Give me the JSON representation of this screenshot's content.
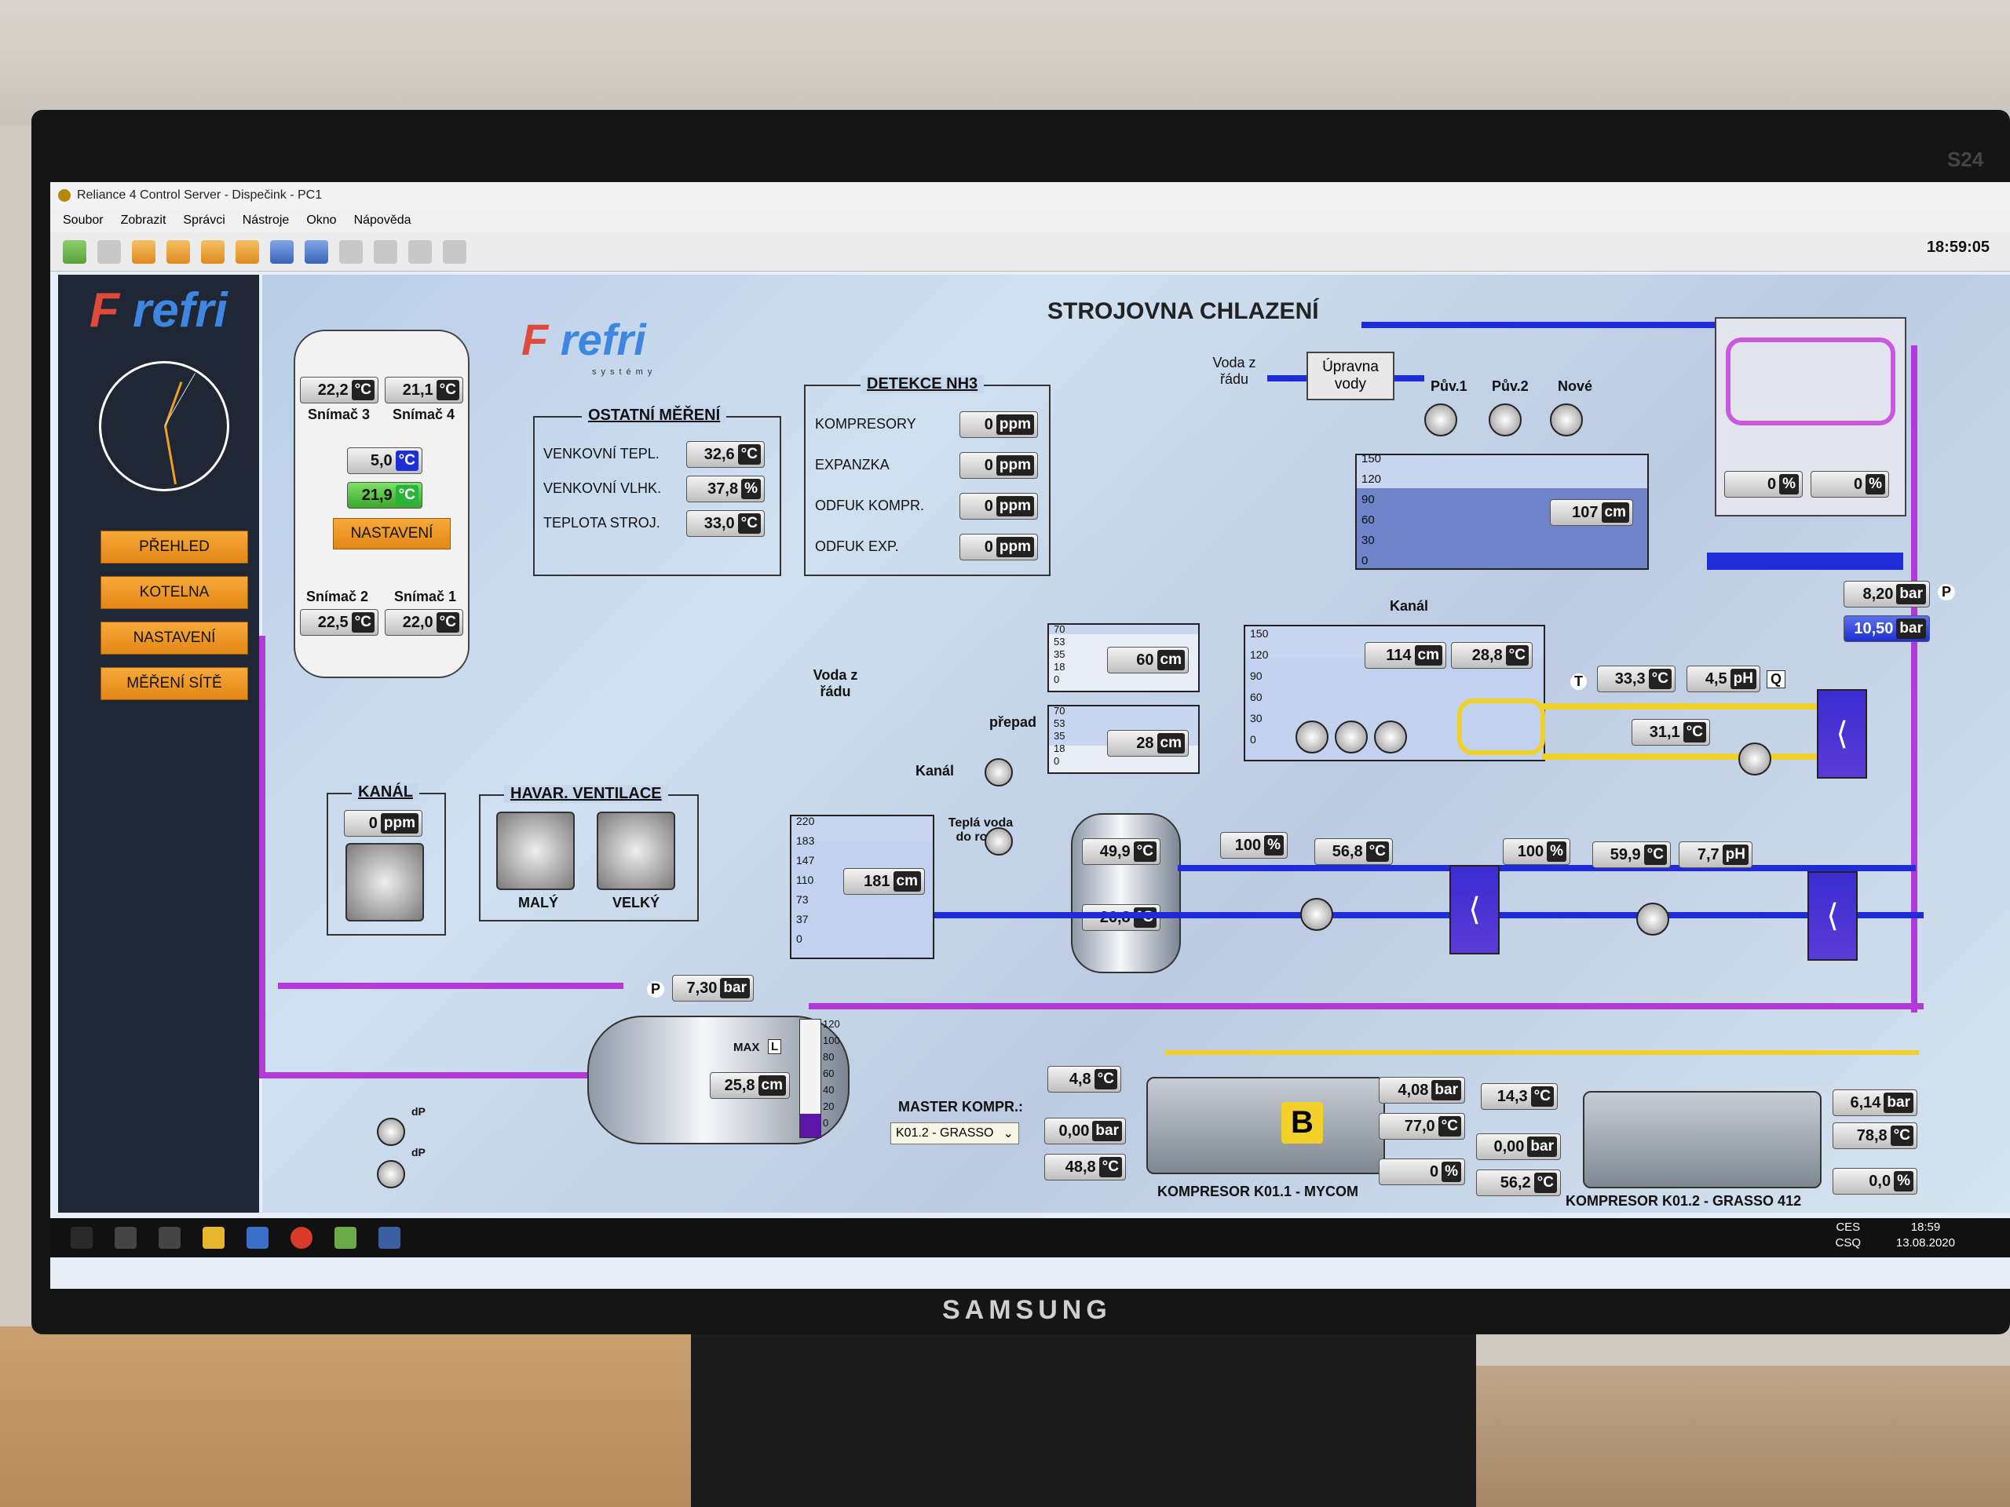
{
  "window": {
    "title": "Reliance 4 Control Server - Dispečink - PC1"
  },
  "menu": [
    "Soubor",
    "Zobrazit",
    "Správci",
    "Nástroje",
    "Okno",
    "Nápověda"
  ],
  "toolbar": {
    "time": "18:59:05"
  },
  "sidebar": {
    "logo": "refri",
    "nav": [
      "PŘEHLED",
      "KOTELNA",
      "NASTAVENÍ",
      "MĚŘENÍ SÍTĚ"
    ]
  },
  "main": {
    "title": "STROJOVNA CHLAZENÍ",
    "logo": "refri",
    "logo_sub": "systémy",
    "rink": {
      "s3": {
        "value": "22,2",
        "unit": "°C",
        "label": "Snímač 3"
      },
      "s4": {
        "value": "21,1",
        "unit": "°C",
        "label": "Snímač 4"
      },
      "blue_temp": {
        "value": "5,0",
        "unit": "°C"
      },
      "green_temp": {
        "value": "21,9",
        "unit": "°C"
      },
      "settings": "NASTAVENÍ",
      "s2": {
        "value": "22,5",
        "unit": "°C",
        "label": "Snímač 2"
      },
      "s1": {
        "value": "22,0",
        "unit": "°C",
        "label": "Snímač 1"
      }
    },
    "other_measurements": {
      "title": "OSTATNÍ MĚŘENÍ",
      "rows": [
        {
          "label": "VENKOVNÍ TEPL.",
          "value": "32,6",
          "unit": "°C"
        },
        {
          "label": "VENKOVNÍ VLHK.",
          "value": "37,8",
          "unit": "%"
        },
        {
          "label": "TEPLOTA STROJ.",
          "value": "33,0",
          "unit": "°C"
        }
      ]
    },
    "nh3": {
      "title": "DETEKCE NH3",
      "rows": [
        {
          "label": "KOMPRESORY",
          "value": "0",
          "unit": "ppm"
        },
        {
          "label": "EXPANZKA",
          "value": "0",
          "unit": "ppm"
        },
        {
          "label": "ODFUK KOMPR.",
          "value": "0",
          "unit": "ppm"
        },
        {
          "label": "ODFUK EXP.",
          "value": "0",
          "unit": "ppm"
        }
      ]
    },
    "water_treatment": {
      "source_label": "Voda z řádu",
      "box": "Úpravna vody",
      "pumps": [
        "Pův.1",
        "Pův.2",
        "Nové"
      ],
      "tank_scale": [
        "150",
        "120",
        "90",
        "60",
        "30",
        "0"
      ],
      "tank_level": {
        "value": "107",
        "unit": "cm"
      }
    },
    "cooling_tower": {
      "v1": {
        "value": "0",
        "unit": "%"
      },
      "v2": {
        "value": "0",
        "unit": "%"
      },
      "p1": {
        "value": "8,20",
        "unit": "bar"
      },
      "p2": {
        "value": "10,50",
        "unit": "bar"
      },
      "p_tag": "P"
    },
    "upper_tanks": {
      "scale": [
        "70",
        "53",
        "35",
        "18",
        "0"
      ],
      "t1": {
        "value": "60",
        "unit": "cm"
      },
      "overflow_label": "přepad",
      "t2": {
        "value": "28",
        "unit": "cm"
      },
      "canal_label": "Kanál"
    },
    "canal_tank": {
      "label": "Kanál",
      "scale": [
        "150",
        "120",
        "90",
        "60",
        "30",
        "0"
      ],
      "level": {
        "value": "114",
        "unit": "cm"
      },
      "temp": {
        "value": "28,8",
        "unit": "°C"
      }
    },
    "right_loop": {
      "t1": {
        "value": "33,3",
        "unit": "°C"
      },
      "ph1": {
        "value": "4,5",
        "unit": "pH"
      },
      "t2": {
        "value": "31,1",
        "unit": "°C"
      },
      "t_tag": "T",
      "q_tag": "Q"
    },
    "hot_water": {
      "source_label": "Voda z řádu",
      "scale": [
        "220",
        "183",
        "147",
        "110",
        "73",
        "37",
        "0"
      ],
      "level": {
        "value": "181",
        "unit": "cm"
      },
      "out_label": "Teplá voda do rolby",
      "tank_top": {
        "value": "49,9",
        "unit": "°C"
      },
      "tank_bottom": {
        "value": "26,8",
        "unit": "°C"
      }
    },
    "middle_loop": {
      "valve1": {
        "value": "100",
        "unit": "%"
      },
      "t1": {
        "value": "56,8",
        "unit": "°C"
      },
      "valve2": {
        "value": "100",
        "unit": "%"
      },
      "t2": {
        "value": "59,9",
        "unit": "°C"
      },
      "ph": {
        "value": "7,7",
        "unit": "pH"
      }
    },
    "canal_panel": {
      "title": "KANÁL",
      "value": "0",
      "unit": "ppm"
    },
    "ventilation": {
      "title": "HAVAR. VENTILACE",
      "fans": [
        "MALÝ",
        "VELKÝ"
      ]
    },
    "receiver": {
      "pressure": {
        "value": "7,30",
        "unit": "bar"
      },
      "p_tag": "P",
      "max_label": "MAX",
      "max_tag": "L",
      "level": {
        "value": "25,8",
        "unit": "cm"
      },
      "scale": [
        "120",
        "100",
        "80",
        "60",
        "40",
        "20",
        "0"
      ],
      "level_pct": 0.2
    },
    "dp_tags": [
      "dP",
      "dP"
    ],
    "master": {
      "label": "MASTER KOMPR.:",
      "selected": "K01.2 - GRASSO"
    },
    "k1": {
      "name": "KOMPRESOR K01.1 - MYCOM",
      "badge": "B",
      "left": [
        {
          "value": "4,8",
          "unit": "°C"
        },
        {
          "value": "0,00",
          "unit": "bar"
        },
        {
          "value": "48,8",
          "unit": "°C"
        }
      ],
      "right": [
        {
          "value": "4,08",
          "unit": "bar"
        },
        {
          "value": "77,0",
          "unit": "°C"
        },
        {
          "value": "0",
          "unit": "%"
        }
      ]
    },
    "k2": {
      "name": "KOMPRESOR K01.2 - GRASSO 412",
      "left": [
        {
          "value": "14,3",
          "unit": "°C"
        },
        {
          "value": "0,00",
          "unit": "bar"
        },
        {
          "value": "56,2",
          "unit": "°C"
        }
      ],
      "right": [
        {
          "value": "6,14",
          "unit": "bar"
        },
        {
          "value": "78,8",
          "unit": "°C"
        },
        {
          "value": "0,0",
          "unit": "%"
        }
      ]
    }
  },
  "taskbar": {
    "lang1": "CES",
    "lang2": "CSQ",
    "time": "18:59",
    "date": "13.08.2020"
  },
  "monitor": {
    "brand": "SAMSUNG",
    "corner": "S24"
  }
}
